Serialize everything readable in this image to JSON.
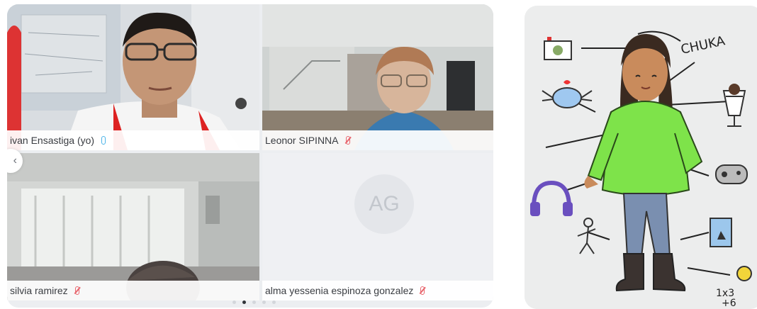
{
  "call": {
    "participants": [
      {
        "name": "ivan Ensastiga (yo)",
        "mic": "on"
      },
      {
        "name": "Leonor SIPINNA",
        "mic": "muted"
      },
      {
        "name": "silvia ramirez",
        "mic": "muted"
      },
      {
        "name": "alma yessenia espinoza gonzalez",
        "mic": "muted",
        "avatar_initials": "AG"
      }
    ],
    "pagination": {
      "pages": 5,
      "active": 2
    }
  },
  "illustration": {
    "signature_text": "CHUKA",
    "math_text": [
      "1x3",
      "+6"
    ]
  }
}
